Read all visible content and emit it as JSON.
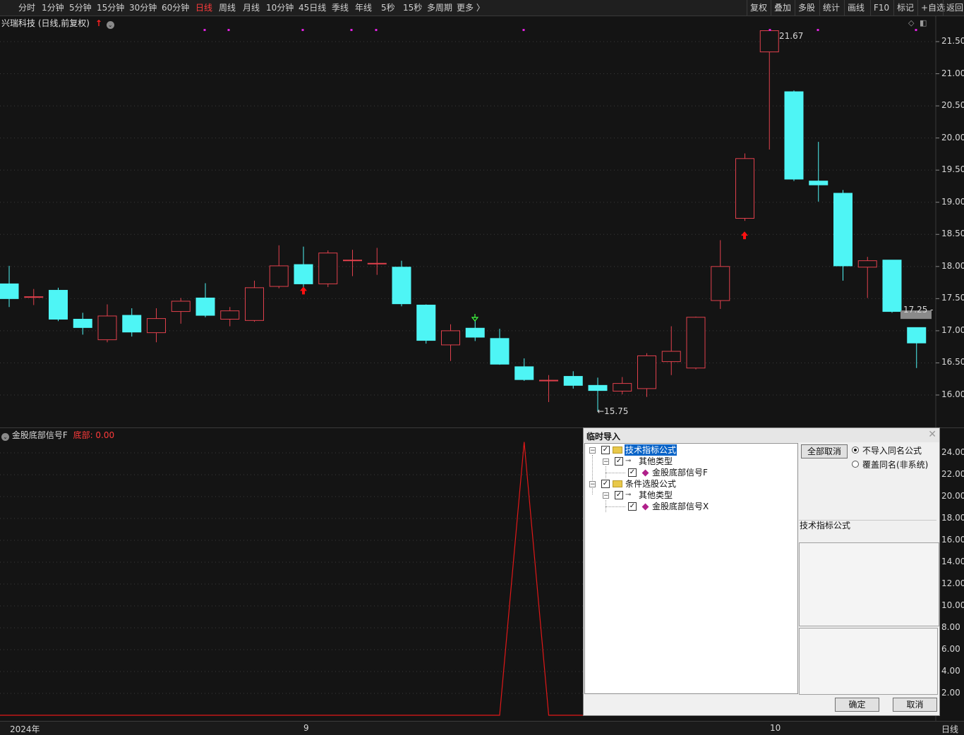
{
  "toolbar": {
    "periods": [
      "分时",
      "1分钟",
      "5分钟",
      "15分钟",
      "30分钟",
      "60分钟",
      "日线",
      "周线",
      "月线",
      "10分钟",
      "45日线",
      "季线",
      "年线",
      "5秒",
      "15秒",
      "多周期",
      "更多 〉"
    ],
    "active_period": "日线",
    "right_items": [
      "复权",
      "叠加",
      "多股",
      "统计",
      "画线",
      "F10",
      "标记",
      "+自选",
      "返回"
    ]
  },
  "stock": {
    "title": "兴瑞科技 (日线,前复权)"
  },
  "price_axis": {
    "labels": [
      "21.50",
      "21.00",
      "20.50",
      "20.00",
      "19.50",
      "19.00",
      "18.50",
      "18.00",
      "17.50",
      "17.00",
      "16.50",
      "16.00"
    ]
  },
  "annotations": {
    "high": "21.67",
    "low": "←15.75",
    "current": "17.25 -"
  },
  "indicator": {
    "name": "金股底部信号F",
    "status": "底部: 0.00",
    "axis_labels": [
      "24.00",
      "22.00",
      "20.00",
      "18.00",
      "16.00",
      "14.00",
      "12.00",
      "10.00",
      "8.00",
      "6.00",
      "4.00",
      "2.00"
    ]
  },
  "x_axis": {
    "labels": [
      "2024年",
      "9",
      "10",
      "日线"
    ]
  },
  "colors": {
    "up": "#e0404c",
    "down": "#4ef5f5",
    "indicator_line": "#e01818",
    "marker": "#e020e0",
    "grid": "#3a3a3a"
  },
  "chart_data": {
    "type": "candlestick",
    "series": [
      {
        "name": "兴瑞科技",
        "ohlc": [
          [
            17.73,
            18.01,
            17.37,
            17.5
          ],
          [
            17.53,
            17.65,
            17.4,
            17.53
          ],
          [
            17.63,
            17.67,
            17.15,
            17.18
          ],
          [
            17.18,
            17.28,
            16.94,
            17.05
          ],
          [
            16.86,
            17.41,
            16.82,
            17.23
          ],
          [
            17.24,
            17.35,
            16.91,
            16.98
          ],
          [
            16.97,
            17.35,
            16.82,
            17.19
          ],
          [
            17.3,
            17.51,
            17.11,
            17.46
          ],
          [
            17.51,
            17.74,
            17.21,
            17.24
          ],
          [
            17.18,
            17.37,
            17.07,
            17.31
          ],
          [
            17.16,
            17.78,
            17.14,
            17.67
          ],
          [
            17.69,
            18.33,
            17.66,
            18.01
          ],
          [
            18.03,
            18.31,
            17.64,
            17.73
          ],
          [
            17.73,
            18.25,
            17.68,
            18.21
          ],
          [
            18.1,
            18.26,
            17.85,
            18.1
          ],
          [
            18.05,
            18.29,
            17.87,
            18.05
          ],
          [
            17.99,
            18.09,
            17.38,
            17.42
          ],
          [
            17.4,
            17.41,
            16.8,
            16.85
          ],
          [
            16.78,
            17.1,
            16.53,
            17.0
          ],
          [
            17.04,
            17.16,
            16.84,
            16.9
          ],
          [
            16.88,
            17.03,
            16.47,
            16.48
          ],
          [
            16.44,
            16.57,
            16.22,
            16.24
          ],
          [
            16.23,
            16.31,
            15.89,
            16.23
          ],
          [
            16.29,
            16.37,
            16.1,
            16.15
          ],
          [
            16.15,
            16.27,
            15.75,
            16.07
          ],
          [
            16.06,
            16.28,
            16.01,
            16.18
          ],
          [
            16.1,
            16.65,
            15.97,
            16.61
          ],
          [
            16.52,
            17.07,
            16.31,
            16.68
          ],
          [
            16.42,
            17.22,
            16.4,
            17.21
          ],
          [
            17.47,
            18.41,
            17.34,
            18.0
          ],
          [
            18.75,
            19.76,
            18.71,
            19.68
          ],
          [
            21.34,
            21.67,
            19.82,
            21.67
          ],
          [
            20.72,
            20.74,
            19.33,
            19.36
          ],
          [
            19.33,
            19.94,
            19.01,
            19.27
          ],
          [
            19.14,
            19.19,
            17.78,
            18.01
          ],
          [
            17.99,
            18.15,
            17.51,
            18.09
          ],
          [
            18.1,
            18.1,
            17.28,
            17.3
          ],
          [
            17.05,
            17.05,
            16.42,
            16.81
          ]
        ]
      }
    ],
    "indicator_values": [
      0,
      0,
      0,
      0,
      0,
      0,
      0,
      0,
      0,
      0,
      0,
      0,
      0,
      0,
      0,
      0,
      0,
      0,
      0,
      0,
      0,
      25,
      0,
      0,
      0,
      0,
      0,
      0,
      0,
      0,
      0,
      0,
      0,
      0,
      0,
      0,
      0,
      0
    ],
    "price_range": [
      15.55,
      21.8
    ],
    "indicator_range": [
      0,
      25
    ]
  },
  "dialog": {
    "title": "临时导入",
    "tree": {
      "root1": "技术指标公式",
      "child1": "其他类型",
      "leaf1": "金股底部信号F",
      "root2": "条件选股公式",
      "child2": "其他类型",
      "leaf2": "金股底部信号X"
    },
    "cancel_all_label": "全部取消",
    "options": [
      "不导入同名公式",
      "覆盖同名(非系统)"
    ],
    "selected_option": "不导入同名公式",
    "info_label": "技术指标公式",
    "ok_label": "确定",
    "cancel_label": "取消"
  }
}
